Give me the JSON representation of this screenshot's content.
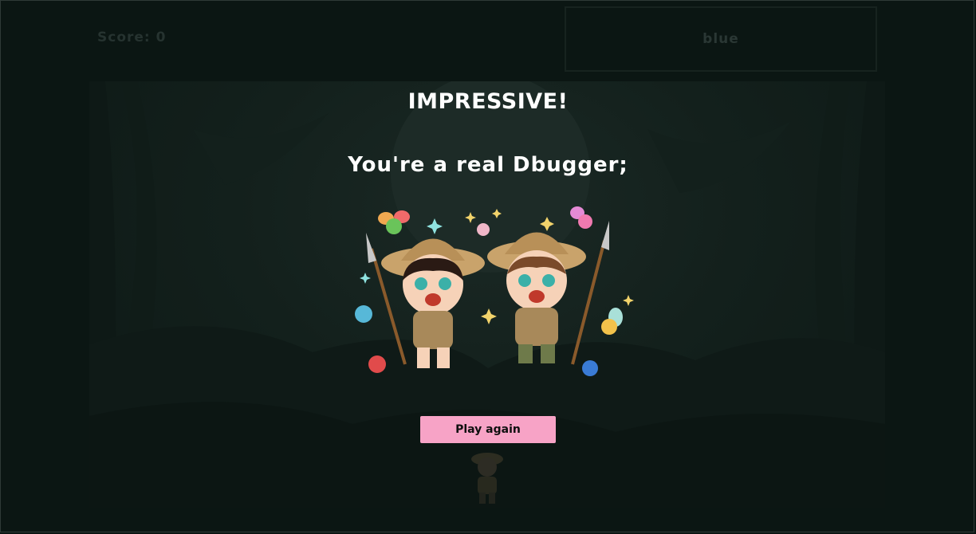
{
  "hud": {
    "score_text": "Score: 0",
    "target_color_word": "blue"
  },
  "result": {
    "title": "IMPRESSIVE!",
    "message": "You're a real Dbugger;"
  },
  "actions": {
    "play_again_label": "Play again"
  },
  "colors": {
    "background": "#0b1613",
    "button": "#f7a3c6",
    "title_text": "#ffffff"
  },
  "icons": [
    "explorer-kids-illustration",
    "bug-icons",
    "spear-icons",
    "sparkle-icons"
  ]
}
